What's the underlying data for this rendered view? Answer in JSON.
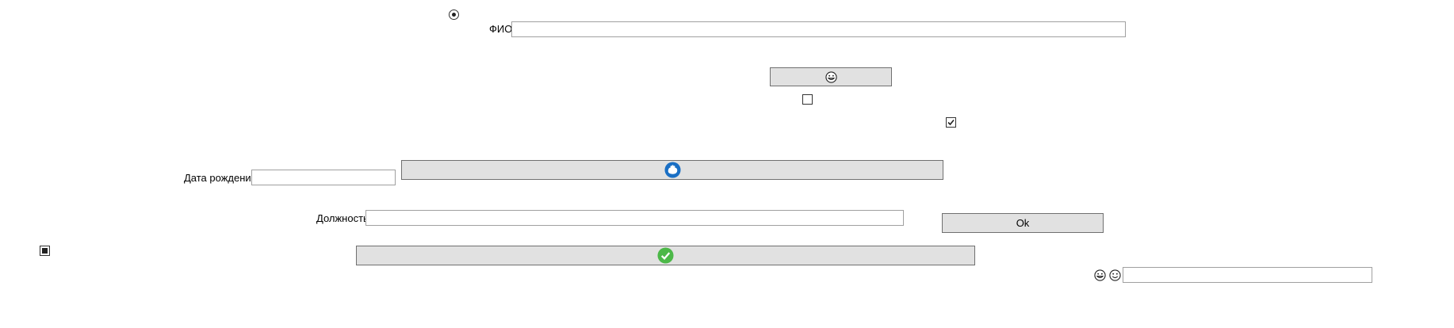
{
  "form": {
    "fio_label": "ФИО",
    "fio_value": "",
    "birth_label": "Дата рождения",
    "birth_value": "",
    "position_label": "Должность",
    "position_value": "",
    "bottom_value": ""
  },
  "buttons": {
    "ok_label": "Ok",
    "smiley_button_icon": "grinning-face-icon",
    "blue_button_icon": "blue-hand-icon",
    "green_button_icon": "green-check-icon"
  },
  "controls": {
    "radio_selected": true,
    "checkbox_1_checked": false,
    "checkbox_2_checked": true,
    "checkbox_3_state": "indeterminate"
  },
  "icons": {
    "inline_1": "grinning-face-icon",
    "inline_2": "smiling-face-icon"
  },
  "colors": {
    "button_bg": "#e1e1e1",
    "blue_icon": "#1a6fc4",
    "green_icon": "#4cb848"
  }
}
